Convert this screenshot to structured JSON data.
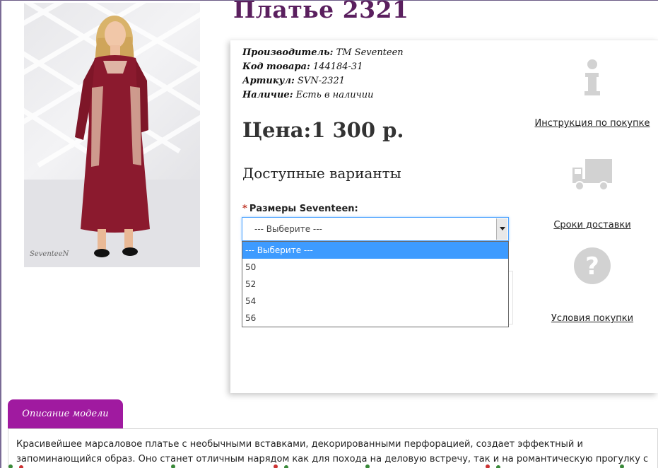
{
  "product": {
    "title": "Платье 2321",
    "image_watermark": "SeventeeN",
    "meta": [
      {
        "label": "Производитель:",
        "value": "TM Seventeen"
      },
      {
        "label": "Код товара:",
        "value": "144184-31"
      },
      {
        "label": "Артикул:",
        "value": "SVN-2321"
      },
      {
        "label": "Наличие:",
        "value": "Есть в наличии"
      }
    ],
    "price": "Цена:1 300 р.",
    "variants_heading": "Доступные варианты"
  },
  "size_select": {
    "label": "Размеры Seventeen:",
    "selected": "--- Выберите ---",
    "options": [
      "--- Выберите ---",
      "50",
      "52",
      "54",
      "56"
    ]
  },
  "sidebar_links": [
    {
      "label": "Инструкция по покупке",
      "icon": "info-icon"
    },
    {
      "label": "Сроки доставки",
      "icon": "truck-icon"
    },
    {
      "label": "Условия покупки",
      "icon": "question-icon"
    }
  ],
  "description": {
    "tab_label": "Описание модели",
    "text": "Красивейшее марсаловое платье с необычными вставками, декорированными перфорацией, создает эффектный и запоминающийся образ. Оно станет отличным нарядом как для похода на деловую встречу, так и на романтическую прогулку с любимым. Платье цвета"
  },
  "colors": {
    "title": "#5a1f5e",
    "tab": "#a01aa0",
    "highlight": "#3d9bff",
    "dress": "#8b1a2e"
  }
}
